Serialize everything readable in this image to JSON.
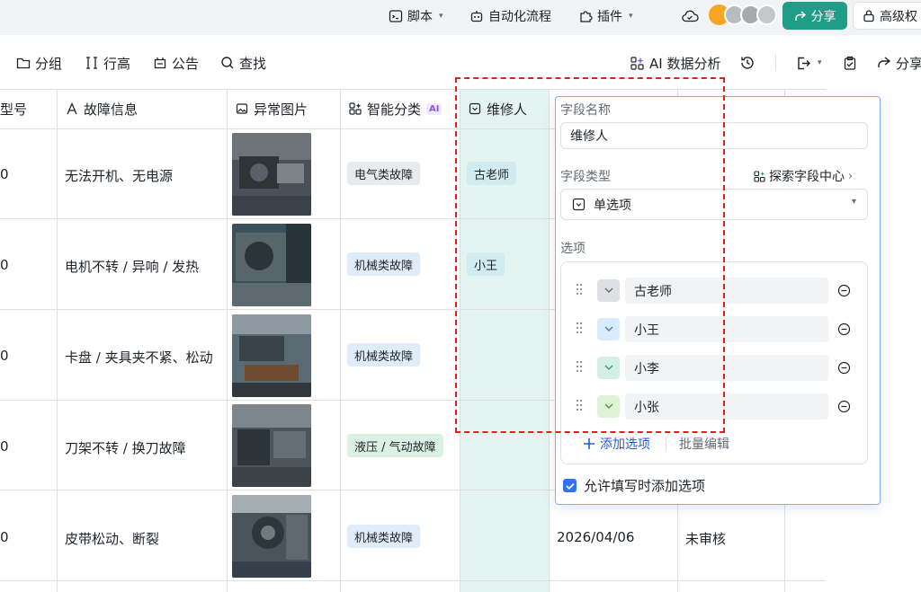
{
  "topbar": {
    "script_label": "脚本",
    "automation_label": "自动化流程",
    "plugin_label": "插件",
    "share_label": "分享",
    "permission_label": "高级权"
  },
  "toolbar": {
    "group_label": "分组",
    "row_height_label": "行高",
    "notice_label": "公告",
    "search_label": "查找",
    "ai_label": "AI 数据分析",
    "share_label": "分享"
  },
  "table": {
    "headers": {
      "model": "型号",
      "fault_info": "故障信息",
      "abnormal_image": "异常图片",
      "smart_category": "智能分类",
      "ai_badge": "AI",
      "repairer": "维修人"
    },
    "rows": [
      {
        "model": "0",
        "fault": "无法开机、无电源",
        "category": "电气类故障",
        "repairer": "古老师",
        "date": "",
        "status": ""
      },
      {
        "model": "0",
        "fault": "电机不转 / 异响 / 发热",
        "category": "机械类故障",
        "repairer": "小王",
        "date": "",
        "status": ""
      },
      {
        "model": "0",
        "fault": "卡盘 / 夹具夹不紧、松动",
        "category": "机械类故障",
        "repairer": "",
        "date": "",
        "status": ""
      },
      {
        "model": "0",
        "fault": "刀架不转 / 换刀故障",
        "category": "液压 / 气动故障",
        "repairer": "",
        "date": "",
        "status": ""
      },
      {
        "model": "0",
        "fault": "皮带松动、断裂",
        "category": "机械类故障",
        "repairer": "",
        "date": "2026/04/06",
        "status": "未审核"
      }
    ]
  },
  "field_panel": {
    "field_name_label": "字段名称",
    "field_name_value": "维修人",
    "field_type_label": "字段类型",
    "explore_link": "探索字段中心",
    "field_type_value": "单选项",
    "options_label": "选项",
    "options": [
      {
        "label": "古老师",
        "color": "#dee0e3"
      },
      {
        "label": "小王",
        "color": "#d9ebfc"
      },
      {
        "label": "小李",
        "color": "#d4efe6"
      },
      {
        "label": "小张",
        "color": "#def2d6"
      }
    ],
    "add_option_label": "添加选项",
    "bulk_edit_label": "批量编辑",
    "allow_add_label": "允许填写时添加选项",
    "allow_add_checked": true
  },
  "colors": {
    "accent": "#1f9d86",
    "link_blue": "#245bdb",
    "column_highlight": "#e3f4f1",
    "dashed_frame": "#e02020",
    "category_electric": "#e8eaed",
    "category_mechanical": "#dfedfb",
    "category_hydraulic": "#dcf1e6",
    "repairer_tag": "#d0ecf0"
  }
}
